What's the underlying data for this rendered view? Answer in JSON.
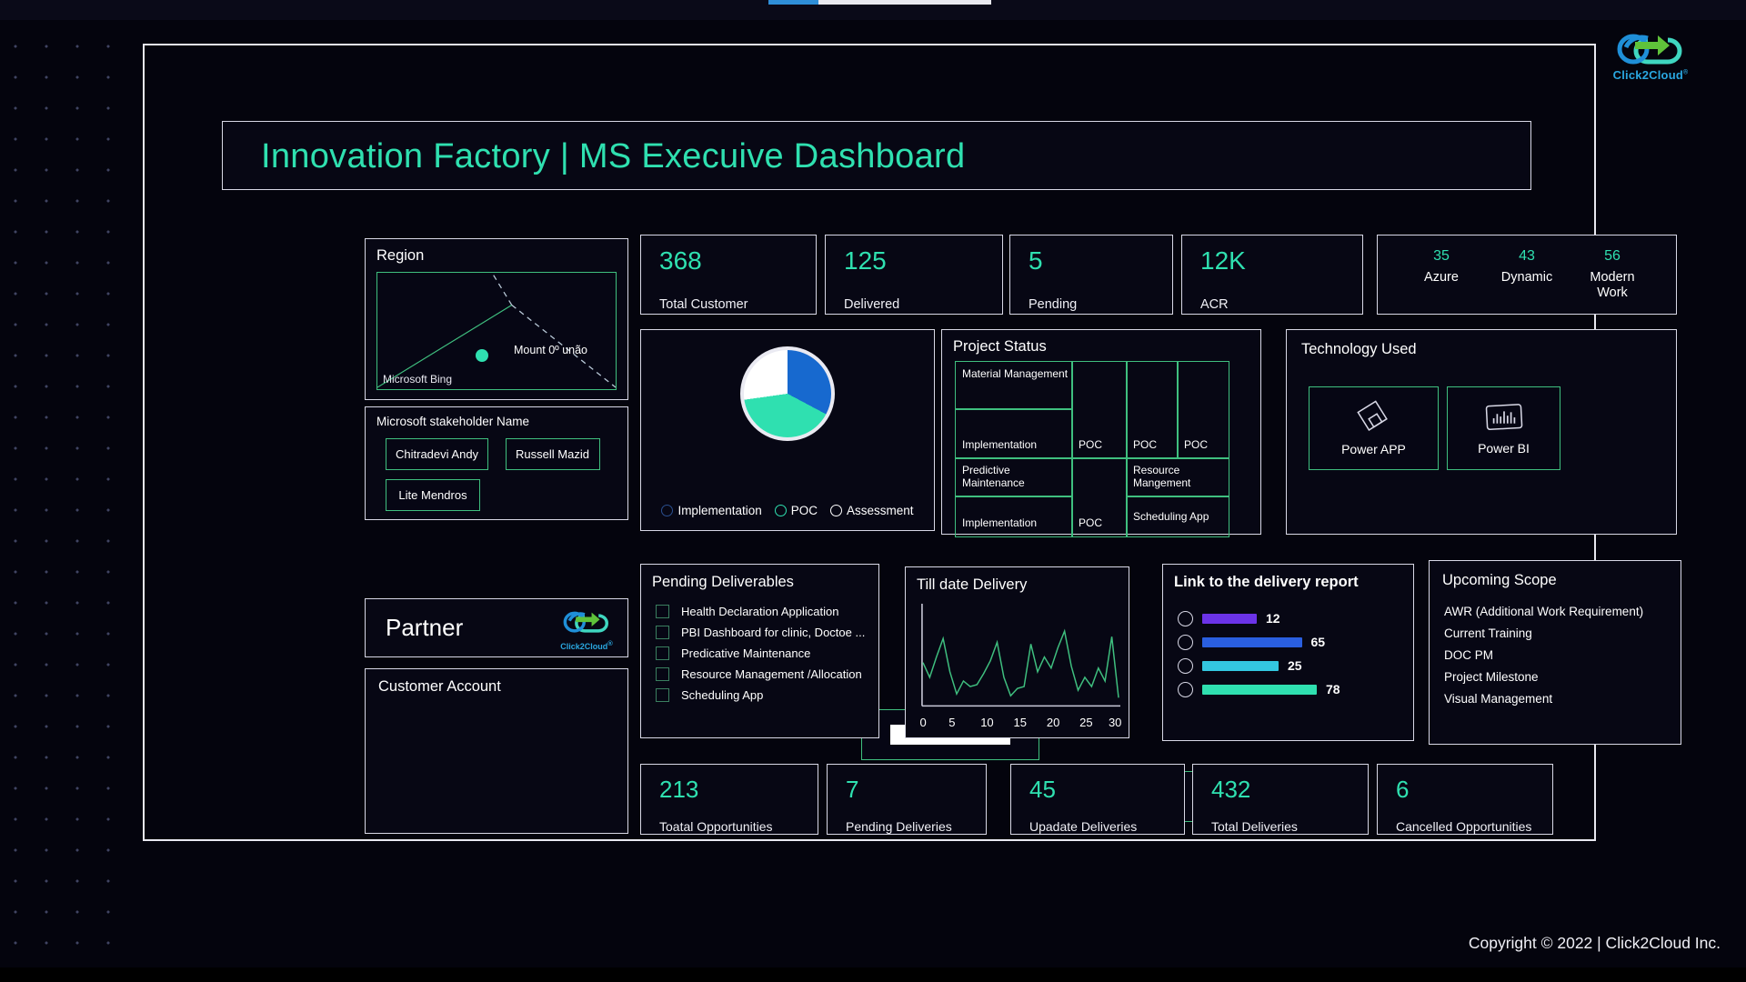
{
  "header": {
    "title": "Innovation Factory | MS Execuive Dashboard",
    "brand_name": "Click2Cloud",
    "brand_mark": "cloud-arrow-logo",
    "brand_sup": "®"
  },
  "kpis_top": [
    {
      "value": "368",
      "label": "Total Customer"
    },
    {
      "value": "125",
      "label": "Delivered"
    },
    {
      "value": "5",
      "label": "Pending"
    },
    {
      "value": "12K",
      "label": "ACR"
    }
  ],
  "workload_mix": [
    {
      "value": "35",
      "name": "Azure"
    },
    {
      "value": "43",
      "name": "Dynamic"
    },
    {
      "value": "56",
      "name": "Modern Work"
    }
  ],
  "region": {
    "title": "Region",
    "attribution": "Microsoft Bing",
    "map_label": "Mount 0º unão"
  },
  "stakeholders": {
    "title": "Microsoft stakeholder Name",
    "names": [
      "Chitradevi Andy",
      "Russell Mazid",
      "Lite Mendros"
    ]
  },
  "partner": {
    "title": "Partner",
    "logo_name": "Click2Cloud",
    "logo_sup": "®"
  },
  "customer_account": {
    "title": "Customer Account",
    "entries": [
      "",
      ""
    ]
  },
  "project_status": {
    "title": "Project Status",
    "cells": [
      "Material Management",
      "Implementation",
      "Predictive Maintenance",
      "Implementation",
      "POC",
      "POC",
      "POC",
      "POC",
      "Resource Mangement",
      "Scheduling App"
    ]
  },
  "technology": {
    "title": "Technology Used",
    "items": [
      {
        "label": "Power APP",
        "icon": "power-apps-diamond-icon"
      },
      {
        "label": "Power BI",
        "icon": "power-bi-bars-icon"
      }
    ]
  },
  "pending_deliverables": {
    "title": "Pending Deliverables",
    "items": [
      "Health Declaration Application",
      "PBI Dashboard for clinic, Doctoe ...",
      "Predicative Maintenance",
      "Resource Management /Allocation",
      "Scheduling App"
    ]
  },
  "upcoming_scope": {
    "title": "Upcoming Scope",
    "items": [
      "AWR (Additional Work Requirement)",
      "Current Training",
      "DOC PM",
      "Project Milestone",
      "Visual Management"
    ]
  },
  "delivery_report": {
    "title": "Link to the delivery report"
  },
  "kpis_bottom": [
    {
      "value": "213",
      "label": "Toatal Opportunities"
    },
    {
      "value": "7",
      "label": "Pending Deliveries"
    },
    {
      "value": "45",
      "label": "Upadate Deliveries"
    },
    {
      "value": "432",
      "label": "Total Deliveries"
    },
    {
      "value": "6",
      "label": "Cancelled Opportunities"
    }
  ],
  "footer": {
    "copyright": "Copyright © 2022 | Click2Cloud Inc."
  },
  "colors": {
    "accent_teal": "#2fe0b0",
    "panel_border": "#d8d8e6",
    "inner_green": "#3fbf7f",
    "background": "#04040d",
    "bar_purple": "#6b33e8",
    "bar_blue": "#2a5fe0",
    "bar_cyan": "#33c7e0",
    "bar_green": "#2fe0b0"
  },
  "chart_data": [
    {
      "type": "pie",
      "title": "",
      "categories": [
        "Implementation",
        "POC",
        "Assessment"
      ],
      "values": [
        33,
        40,
        27
      ],
      "colors": [
        "#1769cf",
        "#2fe0b0",
        "#ffffff"
      ],
      "legend": "bottom",
      "legend_entries": [
        "Implementation",
        "POC",
        "Assessment"
      ]
    },
    {
      "type": "line",
      "title": "Till date Delivery",
      "xlabel": "",
      "ylabel": "",
      "xlim": [
        0,
        30
      ],
      "ylim": [
        0,
        100
      ],
      "xticks": [
        0,
        5,
        10,
        15,
        20,
        25,
        30
      ],
      "grid": false,
      "line_color": "#3fbf7f",
      "x": [
        1,
        2,
        3,
        4,
        5,
        6,
        7,
        8,
        9,
        10,
        11,
        12,
        13,
        14,
        15,
        16,
        17,
        18,
        19,
        20,
        21,
        22,
        23,
        24,
        25,
        26,
        27,
        28,
        29,
        30
      ],
      "values": [
        46,
        30,
        52,
        72,
        36,
        12,
        26,
        20,
        22,
        34,
        48,
        68,
        30,
        10,
        18,
        20,
        66,
        36,
        52,
        40,
        62,
        80,
        42,
        16,
        30,
        20,
        40,
        26,
        74,
        8
      ]
    },
    {
      "type": "bar",
      "orientation": "horizontal",
      "title": "Link to the delivery report",
      "categories": [
        "",
        "",
        "",
        ""
      ],
      "values": [
        12,
        65,
        25,
        78
      ],
      "bar_widths_pct": [
        40,
        73,
        56,
        84
      ],
      "colors": [
        "#6b33e8",
        "#2a5fe0",
        "#33c7e0",
        "#2fe0b0"
      ],
      "xlabel": "",
      "ylabel": "",
      "grid": false
    }
  ]
}
